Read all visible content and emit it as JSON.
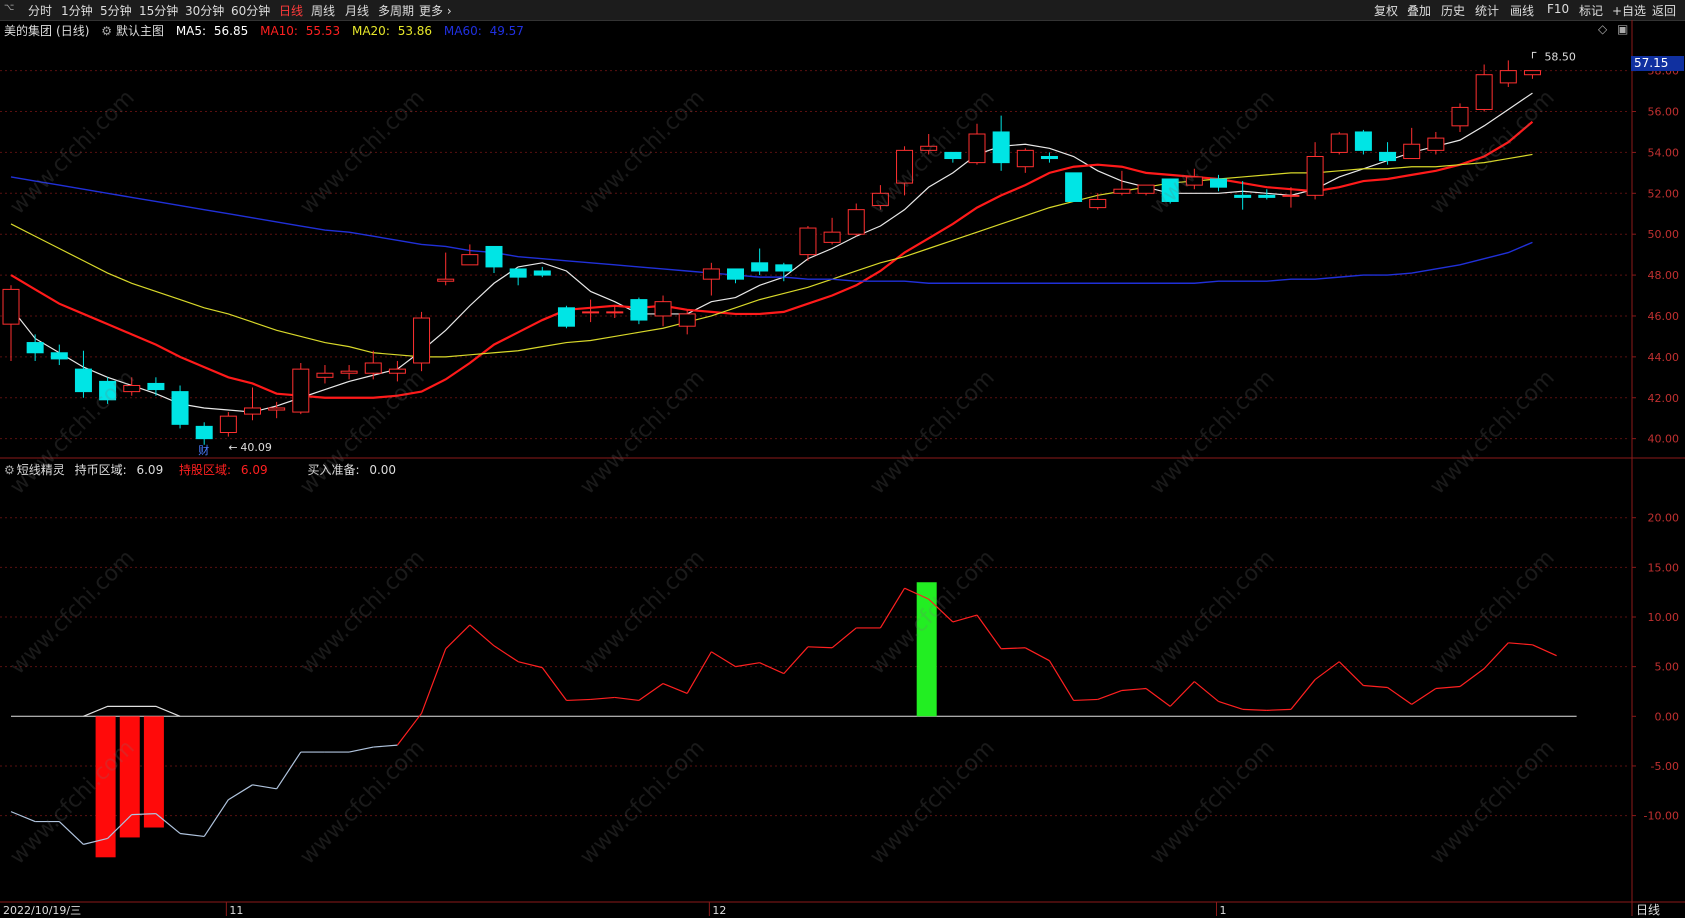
{
  "toolbar": {
    "left_items": [
      "分时",
      "1分钟",
      "5分钟",
      "15分钟",
      "30分钟",
      "60分钟",
      "日线",
      "周线",
      "月线",
      "多周期",
      "更多 ›"
    ],
    "active_item": "日线",
    "right_items": [
      "复权",
      "叠加",
      "历史",
      "统计",
      "画线",
      "F10",
      "标记",
      "+自选",
      "返回"
    ]
  },
  "main": {
    "stock_name": "美的集团",
    "period": "(日线)",
    "indicator_name": "默认主图",
    "ma5": {
      "label": "MA5:",
      "value": "56.85",
      "color": "#ffffff"
    },
    "ma10": {
      "label": "MA10:",
      "value": "55.53",
      "color": "#ff2020"
    },
    "ma20": {
      "label": "MA20:",
      "value": "53.86",
      "color": "#e6e62a"
    },
    "ma60": {
      "label": "MA60:",
      "value": "49.57",
      "color": "#2030e0"
    },
    "y_ticks": [
      "58.00",
      "56.00",
      "54.00",
      "52.00",
      "50.00",
      "48.00",
      "46.00",
      "44.00",
      "42.00",
      "40.00"
    ],
    "current_price": "57.15",
    "high_label": "58.50",
    "low_label": "40.09",
    "fin_label": "财"
  },
  "sub": {
    "indicator_name": "短线精灵",
    "hold_coin_label": "持币区域:",
    "hold_coin_value": "6.09",
    "hold_stock_label": "持股区域:",
    "hold_stock_value": "6.09",
    "buy_label": "买入准备:",
    "buy_value": "0.00",
    "y_ticks": [
      "20.00",
      "15.00",
      "10.00",
      "5.00",
      "0.00",
      "-5.00",
      "-10.00"
    ]
  },
  "x_axis": {
    "date": "2022/10/19/三",
    "month_labels": [
      "11",
      "12",
      "1"
    ],
    "period_label": "日线"
  },
  "watermark": "www.cfchi.com",
  "chart_data": {
    "type": "candlestick",
    "candles": [
      [
        45.6,
        47.3,
        47.5,
        43.8
      ],
      [
        44.7,
        44.2,
        45.1,
        43.8
      ],
      [
        44.2,
        43.9,
        44.6,
        43.6
      ],
      [
        43.4,
        42.3,
        44.3,
        42.0
      ],
      [
        42.8,
        41.9,
        43.0,
        41.7
      ],
      [
        42.3,
        42.6,
        43.0,
        42.1
      ],
      [
        42.7,
        42.4,
        43.0,
        42.1
      ],
      [
        42.3,
        40.7,
        42.6,
        40.5
      ],
      [
        40.6,
        40.0,
        40.8,
        39.7
      ],
      [
        40.3,
        41.1,
        41.3,
        40.1
      ],
      [
        41.2,
        41.5,
        42.5,
        40.9
      ],
      [
        41.4,
        41.5,
        41.8,
        41.0
      ],
      [
        41.3,
        43.4,
        43.7,
        41.2
      ],
      [
        43.0,
        43.2,
        43.6,
        42.7
      ],
      [
        43.2,
        43.3,
        43.6,
        42.9
      ],
      [
        43.2,
        43.7,
        44.3,
        42.9
      ],
      [
        43.2,
        43.4,
        43.8,
        42.8
      ],
      [
        43.7,
        45.9,
        46.2,
        43.3
      ],
      [
        47.7,
        47.8,
        49.1,
        47.5
      ],
      [
        48.5,
        49.0,
        49.5,
        48.5
      ],
      [
        49.4,
        48.4,
        49.4,
        48.1
      ],
      [
        48.3,
        47.9,
        48.3,
        47.5
      ],
      [
        48.2,
        48.0,
        48.4,
        47.9
      ],
      [
        46.4,
        45.5,
        46.5,
        45.4
      ],
      [
        46.2,
        46.2,
        46.8,
        45.7
      ],
      [
        46.2,
        46.2,
        46.5,
        45.9
      ],
      [
        46.8,
        45.8,
        46.9,
        45.6
      ],
      [
        46.0,
        46.7,
        47.0,
        45.5
      ],
      [
        45.5,
        46.1,
        46.3,
        45.1
      ],
      [
        47.8,
        48.3,
        48.6,
        47.0
      ],
      [
        48.3,
        47.8,
        48.2,
        47.6
      ],
      [
        48.6,
        48.2,
        49.3,
        48.0
      ],
      [
        48.5,
        48.2,
        48.6,
        47.7
      ],
      [
        49.0,
        50.3,
        50.4,
        48.7
      ],
      [
        49.6,
        50.1,
        50.8,
        49.5
      ],
      [
        50.0,
        51.2,
        51.5,
        49.9
      ],
      [
        51.4,
        52.0,
        52.4,
        51.2
      ],
      [
        52.5,
        54.1,
        54.3,
        51.9
      ],
      [
        54.1,
        54.3,
        54.9,
        53.9
      ],
      [
        54.0,
        53.7,
        54.0,
        53.5
      ],
      [
        53.5,
        54.9,
        55.4,
        53.4
      ],
      [
        55.0,
        53.5,
        55.8,
        53.1
      ],
      [
        53.3,
        54.1,
        54.2,
        53.0
      ],
      [
        53.8,
        53.7,
        54.0,
        53.5
      ],
      [
        53.0,
        51.6,
        53.0,
        51.6
      ],
      [
        51.3,
        51.7,
        52.0,
        51.2
      ],
      [
        52.0,
        52.2,
        53.1,
        51.9
      ],
      [
        52.0,
        52.4,
        52.4,
        51.9
      ],
      [
        52.7,
        51.6,
        52.7,
        51.5
      ],
      [
        52.4,
        52.8,
        53.2,
        52.2
      ],
      [
        52.7,
        52.3,
        52.9,
        52.1
      ],
      [
        51.9,
        51.8,
        52.6,
        51.2
      ],
      [
        51.9,
        51.8,
        52.2,
        51.7
      ],
      [
        51.9,
        51.9,
        52.3,
        51.3
      ],
      [
        51.9,
        53.8,
        54.5,
        51.7
      ],
      [
        54.0,
        54.9,
        55.0,
        53.9
      ],
      [
        55.0,
        54.1,
        55.1,
        53.9
      ],
      [
        54.0,
        53.6,
        54.5,
        53.4
      ],
      [
        53.7,
        54.4,
        55.2,
        53.7
      ],
      [
        54.1,
        54.7,
        55.0,
        53.9
      ],
      [
        55.3,
        56.2,
        56.4,
        55.0
      ],
      [
        56.1,
        57.8,
        58.3,
        56.0
      ],
      [
        57.4,
        58.0,
        58.5,
        57.2
      ],
      [
        57.8,
        58.0,
        58.0,
        57.6
      ]
    ],
    "ma_lines": [
      {
        "name": "MA5",
        "values": [
          46.4,
          44.9,
          44.2,
          43.5,
          43.0,
          42.6,
          42.2,
          41.7,
          41.5,
          41.4,
          41.3,
          41.6,
          42.0,
          42.4,
          42.8,
          43.1,
          43.4,
          44.3,
          45.3,
          46.5,
          47.6,
          48.4,
          48.6,
          48.2,
          47.2,
          46.7,
          46.1,
          46.1,
          46.1,
          46.7,
          46.9,
          47.5,
          47.9,
          48.8,
          49.3,
          49.9,
          50.4,
          51.2,
          52.3,
          53.0,
          53.9,
          54.3,
          54.4,
          54.2,
          53.8,
          53.1,
          52.6,
          52.3,
          52.0,
          52.0,
          52.0,
          52.1,
          52.0,
          51.9,
          52.2,
          52.8,
          53.2,
          53.6,
          54.0,
          54.3,
          54.6,
          55.3,
          56.1,
          56.9
        ]
      },
      {
        "name": "MA10",
        "values": [
          48.0,
          47.3,
          46.6,
          46.1,
          45.6,
          45.1,
          44.6,
          44.0,
          43.5,
          43.0,
          42.7,
          42.2,
          42.1,
          42.0,
          42.0,
          42.0,
          42.1,
          42.3,
          42.9,
          43.7,
          44.6,
          45.2,
          45.8,
          46.3,
          46.4,
          46.5,
          46.4,
          46.5,
          46.3,
          46.2,
          46.1,
          46.1,
          46.2,
          46.6,
          47.0,
          47.5,
          48.2,
          49.1,
          49.8,
          50.5,
          51.3,
          51.9,
          52.4,
          53.0,
          53.3,
          53.4,
          53.3,
          53.0,
          52.9,
          52.8,
          52.7,
          52.5,
          52.3,
          52.2,
          52.1,
          52.3,
          52.6,
          52.7,
          52.9,
          53.1,
          53.4,
          53.8,
          54.5,
          55.5
        ]
      },
      {
        "name": "MA20",
        "values": [
          50.5,
          49.9,
          49.3,
          48.7,
          48.1,
          47.6,
          47.2,
          46.8,
          46.4,
          46.1,
          45.7,
          45.3,
          45.0,
          44.7,
          44.5,
          44.2,
          44.1,
          44.0,
          44.0,
          44.1,
          44.2,
          44.3,
          44.5,
          44.7,
          44.8,
          45.0,
          45.2,
          45.4,
          45.7,
          46.0,
          46.4,
          46.8,
          47.1,
          47.4,
          47.8,
          48.2,
          48.6,
          48.9,
          49.3,
          49.7,
          50.1,
          50.5,
          50.9,
          51.3,
          51.6,
          51.9,
          52.1,
          52.3,
          52.5,
          52.6,
          52.7,
          52.8,
          52.9,
          53.0,
          53.0,
          53.1,
          53.2,
          53.2,
          53.3,
          53.3,
          53.4,
          53.5,
          53.7,
          53.9
        ]
      },
      {
        "name": "MA60",
        "values": [
          52.8,
          52.6,
          52.4,
          52.2,
          52.0,
          51.8,
          51.6,
          51.4,
          51.2,
          51.0,
          50.8,
          50.6,
          50.4,
          50.2,
          50.1,
          49.9,
          49.7,
          49.5,
          49.4,
          49.2,
          49.1,
          48.9,
          48.8,
          48.7,
          48.6,
          48.5,
          48.4,
          48.3,
          48.2,
          48.1,
          48.0,
          47.9,
          47.9,
          47.8,
          47.8,
          47.7,
          47.7,
          47.7,
          47.6,
          47.6,
          47.6,
          47.6,
          47.6,
          47.6,
          47.6,
          47.6,
          47.6,
          47.6,
          47.6,
          47.6,
          47.7,
          47.7,
          47.7,
          47.8,
          47.8,
          47.9,
          48.0,
          48.0,
          48.1,
          48.3,
          48.5,
          48.8,
          49.1,
          49.6
        ]
      }
    ],
    "ylim": [
      39.2,
      59.4
    ],
    "indicator": {
      "line": [
        -9.6,
        -10.6,
        -10.6,
        -12.9,
        -12.3,
        -9.9,
        -9.8,
        -11.8,
        -12.1,
        -8.4,
        -6.9,
        -7.3,
        -3.6,
        -3.6,
        -3.6,
        -3.1,
        -2.9,
        0.3,
        6.8,
        9.2,
        7.1,
        5.5,
        4.9,
        1.6,
        1.7,
        1.9,
        1.6,
        3.3,
        2.3,
        6.5,
        5.0,
        5.4,
        4.3,
        7.0,
        6.9,
        8.9,
        8.9,
        12.9,
        11.8,
        9.5,
        10.2,
        6.8,
        6.9,
        5.6,
        1.6,
        1.7,
        2.6,
        2.8,
        1.0,
        3.5,
        1.5,
        0.7,
        0.6,
        0.7,
        3.7,
        5.5,
        3.1,
        2.9,
        1.2,
        2.8,
        3.0,
        4.8,
        7.4,
        7.2,
        6.1
      ],
      "hold_stock_bars": [
        {
          "index": 4,
          "value": -14.2
        },
        {
          "index": 5,
          "value": -12.2
        },
        {
          "index": 6,
          "value": -11.2
        }
      ],
      "buy_bars": [
        {
          "index": 38,
          "value": 13.5
        }
      ],
      "warn_line": [
        {
          "index": 3,
          "value": 0.0
        },
        {
          "index": 4,
          "value": 1.0
        },
        {
          "index": 5,
          "value": 1.0
        },
        {
          "index": 6,
          "value": 1.0
        },
        {
          "index": 7,
          "value": 0.0
        }
      ],
      "ylim": [
        -18.5,
        24.2
      ]
    }
  }
}
